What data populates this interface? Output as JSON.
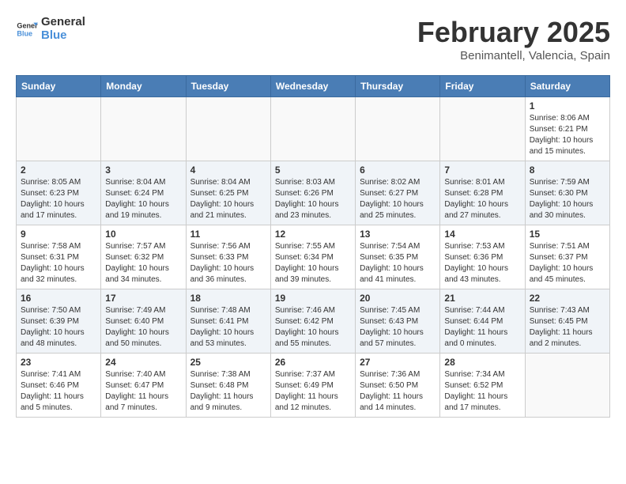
{
  "logo": {
    "text1": "General",
    "text2": "Blue"
  },
  "header": {
    "month": "February 2025",
    "location": "Benimantell, Valencia, Spain"
  },
  "weekdays": [
    "Sunday",
    "Monday",
    "Tuesday",
    "Wednesday",
    "Thursday",
    "Friday",
    "Saturday"
  ],
  "weeks": [
    [
      {
        "day": "",
        "info": ""
      },
      {
        "day": "",
        "info": ""
      },
      {
        "day": "",
        "info": ""
      },
      {
        "day": "",
        "info": ""
      },
      {
        "day": "",
        "info": ""
      },
      {
        "day": "",
        "info": ""
      },
      {
        "day": "1",
        "info": "Sunrise: 8:06 AM\nSunset: 6:21 PM\nDaylight: 10 hours and 15 minutes."
      }
    ],
    [
      {
        "day": "2",
        "info": "Sunrise: 8:05 AM\nSunset: 6:23 PM\nDaylight: 10 hours and 17 minutes."
      },
      {
        "day": "3",
        "info": "Sunrise: 8:04 AM\nSunset: 6:24 PM\nDaylight: 10 hours and 19 minutes."
      },
      {
        "day": "4",
        "info": "Sunrise: 8:04 AM\nSunset: 6:25 PM\nDaylight: 10 hours and 21 minutes."
      },
      {
        "day": "5",
        "info": "Sunrise: 8:03 AM\nSunset: 6:26 PM\nDaylight: 10 hours and 23 minutes."
      },
      {
        "day": "6",
        "info": "Sunrise: 8:02 AM\nSunset: 6:27 PM\nDaylight: 10 hours and 25 minutes."
      },
      {
        "day": "7",
        "info": "Sunrise: 8:01 AM\nSunset: 6:28 PM\nDaylight: 10 hours and 27 minutes."
      },
      {
        "day": "8",
        "info": "Sunrise: 7:59 AM\nSunset: 6:30 PM\nDaylight: 10 hours and 30 minutes."
      }
    ],
    [
      {
        "day": "9",
        "info": "Sunrise: 7:58 AM\nSunset: 6:31 PM\nDaylight: 10 hours and 32 minutes."
      },
      {
        "day": "10",
        "info": "Sunrise: 7:57 AM\nSunset: 6:32 PM\nDaylight: 10 hours and 34 minutes."
      },
      {
        "day": "11",
        "info": "Sunrise: 7:56 AM\nSunset: 6:33 PM\nDaylight: 10 hours and 36 minutes."
      },
      {
        "day": "12",
        "info": "Sunrise: 7:55 AM\nSunset: 6:34 PM\nDaylight: 10 hours and 39 minutes."
      },
      {
        "day": "13",
        "info": "Sunrise: 7:54 AM\nSunset: 6:35 PM\nDaylight: 10 hours and 41 minutes."
      },
      {
        "day": "14",
        "info": "Sunrise: 7:53 AM\nSunset: 6:36 PM\nDaylight: 10 hours and 43 minutes."
      },
      {
        "day": "15",
        "info": "Sunrise: 7:51 AM\nSunset: 6:37 PM\nDaylight: 10 hours and 45 minutes."
      }
    ],
    [
      {
        "day": "16",
        "info": "Sunrise: 7:50 AM\nSunset: 6:39 PM\nDaylight: 10 hours and 48 minutes."
      },
      {
        "day": "17",
        "info": "Sunrise: 7:49 AM\nSunset: 6:40 PM\nDaylight: 10 hours and 50 minutes."
      },
      {
        "day": "18",
        "info": "Sunrise: 7:48 AM\nSunset: 6:41 PM\nDaylight: 10 hours and 53 minutes."
      },
      {
        "day": "19",
        "info": "Sunrise: 7:46 AM\nSunset: 6:42 PM\nDaylight: 10 hours and 55 minutes."
      },
      {
        "day": "20",
        "info": "Sunrise: 7:45 AM\nSunset: 6:43 PM\nDaylight: 10 hours and 57 minutes."
      },
      {
        "day": "21",
        "info": "Sunrise: 7:44 AM\nSunset: 6:44 PM\nDaylight: 11 hours and 0 minutes."
      },
      {
        "day": "22",
        "info": "Sunrise: 7:43 AM\nSunset: 6:45 PM\nDaylight: 11 hours and 2 minutes."
      }
    ],
    [
      {
        "day": "23",
        "info": "Sunrise: 7:41 AM\nSunset: 6:46 PM\nDaylight: 11 hours and 5 minutes."
      },
      {
        "day": "24",
        "info": "Sunrise: 7:40 AM\nSunset: 6:47 PM\nDaylight: 11 hours and 7 minutes."
      },
      {
        "day": "25",
        "info": "Sunrise: 7:38 AM\nSunset: 6:48 PM\nDaylight: 11 hours and 9 minutes."
      },
      {
        "day": "26",
        "info": "Sunrise: 7:37 AM\nSunset: 6:49 PM\nDaylight: 11 hours and 12 minutes."
      },
      {
        "day": "27",
        "info": "Sunrise: 7:36 AM\nSunset: 6:50 PM\nDaylight: 11 hours and 14 minutes."
      },
      {
        "day": "28",
        "info": "Sunrise: 7:34 AM\nSunset: 6:52 PM\nDaylight: 11 hours and 17 minutes."
      },
      {
        "day": "",
        "info": ""
      }
    ]
  ]
}
